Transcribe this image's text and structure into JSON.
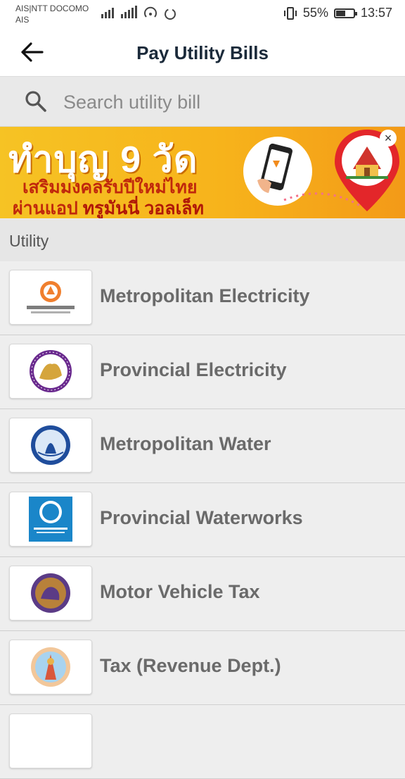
{
  "status_bar": {
    "carrier_line1": "AIS|NTT DOCOMO",
    "carrier_line2": "AIS",
    "battery_percent": "55%",
    "battery_level": 0.55,
    "time": "13:57"
  },
  "header": {
    "title": "Pay Utility Bills",
    "back_icon": "arrow-left-icon"
  },
  "search": {
    "placeholder": "Search utility bill",
    "value": ""
  },
  "banner": {
    "line1": "ทำบุญ 9 วัด",
    "line2": "เสริมมงคลรับปีใหม่ไทย",
    "line3_prefix": "ผ่านแอป ",
    "line3_brand": "ทรูมันนี่ วอลเล็ท",
    "close_label": "×",
    "colors": {
      "bg_start": "#f6c324",
      "bg_end": "#f39a18",
      "text_red": "#c0280c"
    }
  },
  "section": {
    "label": "Utility"
  },
  "utilities": [
    {
      "label": "Metropolitan Electricity",
      "logo": "mea-logo-icon"
    },
    {
      "label": "Provincial Electricity",
      "logo": "pea-logo-icon"
    },
    {
      "label": "Metropolitan Water",
      "logo": "mwa-logo-icon"
    },
    {
      "label": "Provincial Waterworks",
      "logo": "pwa-logo-icon"
    },
    {
      "label": "Motor Vehicle Tax",
      "logo": "dlt-logo-icon"
    },
    {
      "label": "Tax (Revenue Dept.)",
      "logo": "revenue-dept-logo-icon"
    }
  ]
}
